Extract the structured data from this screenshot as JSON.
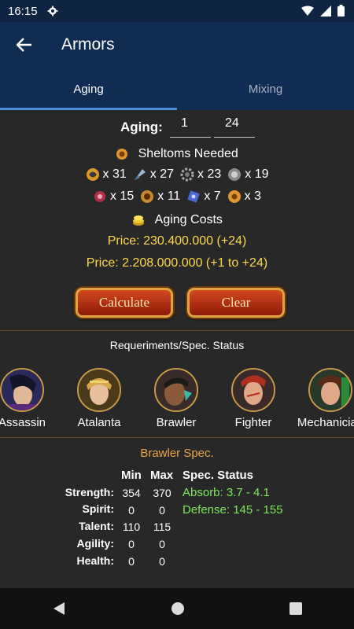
{
  "status_bar": {
    "time": "16:15"
  },
  "app_bar": {
    "title": "Armors"
  },
  "tabs": [
    {
      "label": "Aging",
      "active": true
    },
    {
      "label": "Mixing",
      "active": false
    }
  ],
  "aging": {
    "label": "Aging:",
    "from": "1",
    "to": "24"
  },
  "sheltoms": {
    "header": "Sheltoms Needed",
    "row1": [
      {
        "icon": "sheltom-fadeo-icon",
        "count": "x 31"
      },
      {
        "icon": "sheltom-sparky-icon",
        "count": "x 27"
      },
      {
        "icon": "sheltom-raident-icon",
        "count": "x 23"
      },
      {
        "icon": "sheltom-transparo-icon",
        "count": "x 19"
      }
    ],
    "row2": [
      {
        "icon": "sheltom-murky-icon",
        "count": "x 15"
      },
      {
        "icon": "sheltom-devine-icon",
        "count": "x 11"
      },
      {
        "icon": "sheltom-celesto-icon",
        "count": "x 7"
      },
      {
        "icon": "sheltom-mirage-icon",
        "count": "x 3"
      }
    ]
  },
  "costs": {
    "header": "Aging Costs",
    "price1": "Price:  230.400.000 (+24)",
    "price2": "Price:  2.208.000.000 (+1 to +24)"
  },
  "buttons": {
    "calculate": "Calculate",
    "clear": "Clear"
  },
  "requirements": {
    "title": "Requeriments/Spec. Status",
    "classes": [
      "Assassin",
      "Atalanta",
      "Brawler",
      "Fighter",
      "Mechanician"
    ]
  },
  "spec": {
    "title": "Brawler Spec.",
    "headers": {
      "min": "Min",
      "max": "Max",
      "status": "Spec. Status"
    },
    "rows": [
      {
        "label": "Strength:",
        "min": "354",
        "max": "370"
      },
      {
        "label": "Spirit:",
        "min": "0",
        "max": "0"
      },
      {
        "label": "Talent:",
        "min": "110",
        "max": "115"
      },
      {
        "label": "Agility:",
        "min": "0",
        "max": "0"
      },
      {
        "label": "Health:",
        "min": "0",
        "max": "0"
      }
    ],
    "absorb": "Absorb: 3.7 - 4.1",
    "defense": "Defense: 145 - 155"
  },
  "colors": {
    "accent": "#0f2c52",
    "price": "#ffd84a",
    "spec_title": "#f0a44a",
    "status_green": "#7ee85a"
  }
}
